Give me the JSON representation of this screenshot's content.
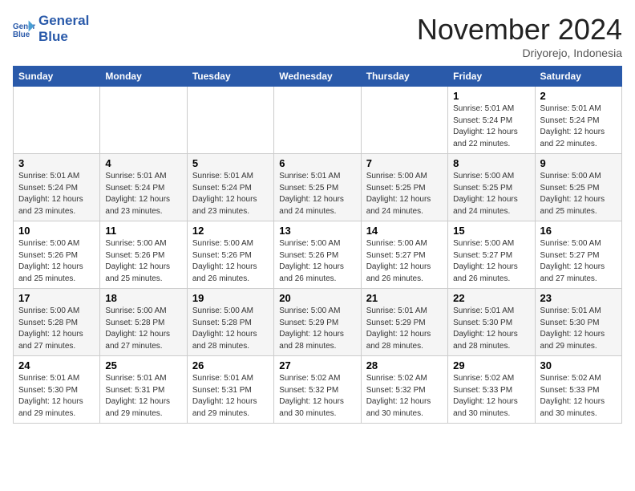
{
  "header": {
    "logo_line1": "General",
    "logo_line2": "Blue",
    "month": "November 2024",
    "location": "Driyorejo, Indonesia"
  },
  "days_of_week": [
    "Sunday",
    "Monday",
    "Tuesday",
    "Wednesday",
    "Thursday",
    "Friday",
    "Saturday"
  ],
  "weeks": [
    [
      {
        "day": "",
        "info": ""
      },
      {
        "day": "",
        "info": ""
      },
      {
        "day": "",
        "info": ""
      },
      {
        "day": "",
        "info": ""
      },
      {
        "day": "",
        "info": ""
      },
      {
        "day": "1",
        "info": "Sunrise: 5:01 AM\nSunset: 5:24 PM\nDaylight: 12 hours\nand 22 minutes."
      },
      {
        "day": "2",
        "info": "Sunrise: 5:01 AM\nSunset: 5:24 PM\nDaylight: 12 hours\nand 22 minutes."
      }
    ],
    [
      {
        "day": "3",
        "info": "Sunrise: 5:01 AM\nSunset: 5:24 PM\nDaylight: 12 hours\nand 23 minutes."
      },
      {
        "day": "4",
        "info": "Sunrise: 5:01 AM\nSunset: 5:24 PM\nDaylight: 12 hours\nand 23 minutes."
      },
      {
        "day": "5",
        "info": "Sunrise: 5:01 AM\nSunset: 5:24 PM\nDaylight: 12 hours\nand 23 minutes."
      },
      {
        "day": "6",
        "info": "Sunrise: 5:01 AM\nSunset: 5:25 PM\nDaylight: 12 hours\nand 24 minutes."
      },
      {
        "day": "7",
        "info": "Sunrise: 5:00 AM\nSunset: 5:25 PM\nDaylight: 12 hours\nand 24 minutes."
      },
      {
        "day": "8",
        "info": "Sunrise: 5:00 AM\nSunset: 5:25 PM\nDaylight: 12 hours\nand 24 minutes."
      },
      {
        "day": "9",
        "info": "Sunrise: 5:00 AM\nSunset: 5:25 PM\nDaylight: 12 hours\nand 25 minutes."
      }
    ],
    [
      {
        "day": "10",
        "info": "Sunrise: 5:00 AM\nSunset: 5:26 PM\nDaylight: 12 hours\nand 25 minutes."
      },
      {
        "day": "11",
        "info": "Sunrise: 5:00 AM\nSunset: 5:26 PM\nDaylight: 12 hours\nand 25 minutes."
      },
      {
        "day": "12",
        "info": "Sunrise: 5:00 AM\nSunset: 5:26 PM\nDaylight: 12 hours\nand 26 minutes."
      },
      {
        "day": "13",
        "info": "Sunrise: 5:00 AM\nSunset: 5:26 PM\nDaylight: 12 hours\nand 26 minutes."
      },
      {
        "day": "14",
        "info": "Sunrise: 5:00 AM\nSunset: 5:27 PM\nDaylight: 12 hours\nand 26 minutes."
      },
      {
        "day": "15",
        "info": "Sunrise: 5:00 AM\nSunset: 5:27 PM\nDaylight: 12 hours\nand 26 minutes."
      },
      {
        "day": "16",
        "info": "Sunrise: 5:00 AM\nSunset: 5:27 PM\nDaylight: 12 hours\nand 27 minutes."
      }
    ],
    [
      {
        "day": "17",
        "info": "Sunrise: 5:00 AM\nSunset: 5:28 PM\nDaylight: 12 hours\nand 27 minutes."
      },
      {
        "day": "18",
        "info": "Sunrise: 5:00 AM\nSunset: 5:28 PM\nDaylight: 12 hours\nand 27 minutes."
      },
      {
        "day": "19",
        "info": "Sunrise: 5:00 AM\nSunset: 5:28 PM\nDaylight: 12 hours\nand 28 minutes."
      },
      {
        "day": "20",
        "info": "Sunrise: 5:00 AM\nSunset: 5:29 PM\nDaylight: 12 hours\nand 28 minutes."
      },
      {
        "day": "21",
        "info": "Sunrise: 5:01 AM\nSunset: 5:29 PM\nDaylight: 12 hours\nand 28 minutes."
      },
      {
        "day": "22",
        "info": "Sunrise: 5:01 AM\nSunset: 5:30 PM\nDaylight: 12 hours\nand 28 minutes."
      },
      {
        "day": "23",
        "info": "Sunrise: 5:01 AM\nSunset: 5:30 PM\nDaylight: 12 hours\nand 29 minutes."
      }
    ],
    [
      {
        "day": "24",
        "info": "Sunrise: 5:01 AM\nSunset: 5:30 PM\nDaylight: 12 hours\nand 29 minutes."
      },
      {
        "day": "25",
        "info": "Sunrise: 5:01 AM\nSunset: 5:31 PM\nDaylight: 12 hours\nand 29 minutes."
      },
      {
        "day": "26",
        "info": "Sunrise: 5:01 AM\nSunset: 5:31 PM\nDaylight: 12 hours\nand 29 minutes."
      },
      {
        "day": "27",
        "info": "Sunrise: 5:02 AM\nSunset: 5:32 PM\nDaylight: 12 hours\nand 30 minutes."
      },
      {
        "day": "28",
        "info": "Sunrise: 5:02 AM\nSunset: 5:32 PM\nDaylight: 12 hours\nand 30 minutes."
      },
      {
        "day": "29",
        "info": "Sunrise: 5:02 AM\nSunset: 5:33 PM\nDaylight: 12 hours\nand 30 minutes."
      },
      {
        "day": "30",
        "info": "Sunrise: 5:02 AM\nSunset: 5:33 PM\nDaylight: 12 hours\nand 30 minutes."
      }
    ]
  ]
}
